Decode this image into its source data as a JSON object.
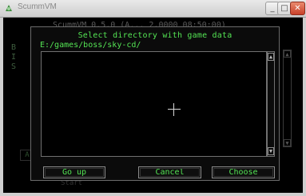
{
  "window": {
    "title": "ScummVM",
    "minimize_label": "_",
    "maximize_label": "□",
    "close_label": "✕"
  },
  "background": {
    "version_text": "ScummVM 0.5.0 (A... 2.0000 08:50:00)",
    "left_chars": [
      "B",
      "I",
      "S"
    ],
    "left_button": "A",
    "bottom_text": "Start",
    "scroll_up": "▲",
    "scroll_down": "▼"
  },
  "dialog": {
    "title": "Select directory with game data",
    "path": "E:/games/boss/sky-cd/",
    "scroll_up": "▲",
    "scroll_down": "▼",
    "buttons": {
      "go_up": "Go up",
      "cancel": "Cancel",
      "choose": "Choose"
    }
  },
  "colors": {
    "text_green": "#54e454",
    "dialog_bg": "#0b0b0b",
    "border_gray": "#707070"
  }
}
